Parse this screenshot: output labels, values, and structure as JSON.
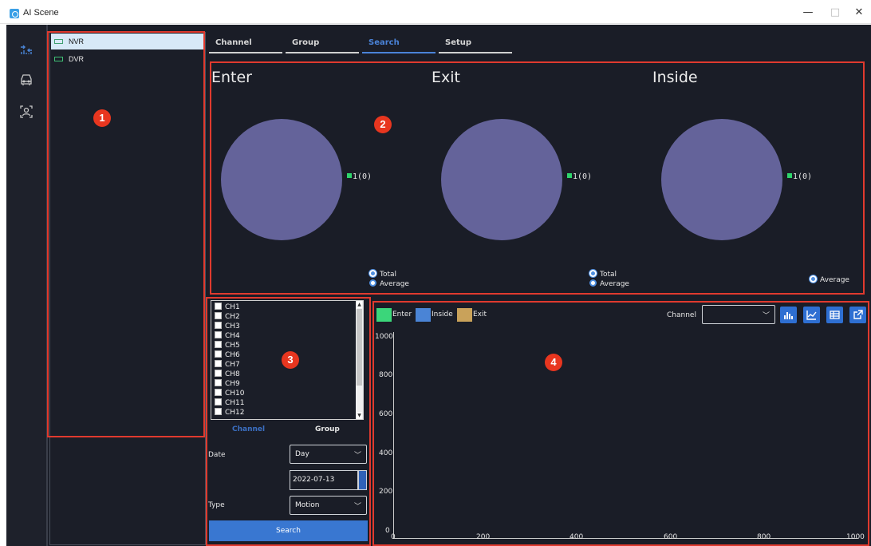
{
  "window": {
    "title": "AI Scene",
    "minimize": "—",
    "maximize": "□",
    "close": "✕"
  },
  "sidebar_icons": [
    "people-count-icon",
    "car-icon",
    "face-scan-icon"
  ],
  "devices": [
    {
      "label": "NVR",
      "selected": true
    },
    {
      "label": "DVR",
      "selected": false
    }
  ],
  "markers": [
    "1",
    "2",
    "3",
    "4"
  ],
  "tabs": [
    {
      "label": "Channel",
      "active": false
    },
    {
      "label": "Group",
      "active": false
    },
    {
      "label": "Search",
      "active": true
    },
    {
      "label": "Setup",
      "active": false
    }
  ],
  "stats": [
    {
      "title": "Enter",
      "legend": "1(0)",
      "radios": [
        {
          "label": "Total",
          "checked": true
        },
        {
          "label": "Average",
          "checked": false
        }
      ]
    },
    {
      "title": "Exit",
      "legend": "1(0)",
      "radios": [
        {
          "label": "Total",
          "checked": true
        },
        {
          "label": "Average",
          "checked": false
        }
      ]
    },
    {
      "title": "Inside",
      "legend": "1(0)",
      "radios": [
        {
          "label": "Average",
          "checked": true
        }
      ]
    }
  ],
  "channels": [
    "CH1",
    "CH2",
    "CH3",
    "CH4",
    "CH5",
    "CH6",
    "CH7",
    "CH8",
    "CH9",
    "CH10",
    "CH11",
    "CH12"
  ],
  "search_form": {
    "sub_tabs": [
      {
        "label": "Channel",
        "active": true
      },
      {
        "label": "Group",
        "active": false
      }
    ],
    "date_label": "Date",
    "date_mode": "Day",
    "date_value": "2022-07-13",
    "type_label": "Type",
    "type_value": "Motion",
    "search_button": "Search"
  },
  "colors": {
    "enter": "#3bd67a",
    "inside": "#4a84d6",
    "exit": "#c9a25a",
    "accent": "#4a83d8",
    "highlight_box": "#e03a2e"
  },
  "chart_toolbar": {
    "channel_label": "Channel",
    "channel_value": "",
    "buttons": [
      "bar-chart-icon",
      "line-chart-icon",
      "table-icon",
      "export-icon"
    ]
  },
  "chart_data": {
    "type": "bar",
    "series": [
      {
        "name": "Enter",
        "values": []
      },
      {
        "name": "Inside",
        "values": []
      },
      {
        "name": "Exit",
        "values": []
      }
    ],
    "x_ticks": [
      "0",
      "200",
      "400",
      "600",
      "800",
      "1000"
    ],
    "y_ticks": [
      "0",
      "200",
      "400",
      "600",
      "800",
      "1000"
    ],
    "xlim": [
      0,
      1000
    ],
    "ylim": [
      0,
      1000
    ],
    "legend_position": "top-left",
    "grid": false
  }
}
